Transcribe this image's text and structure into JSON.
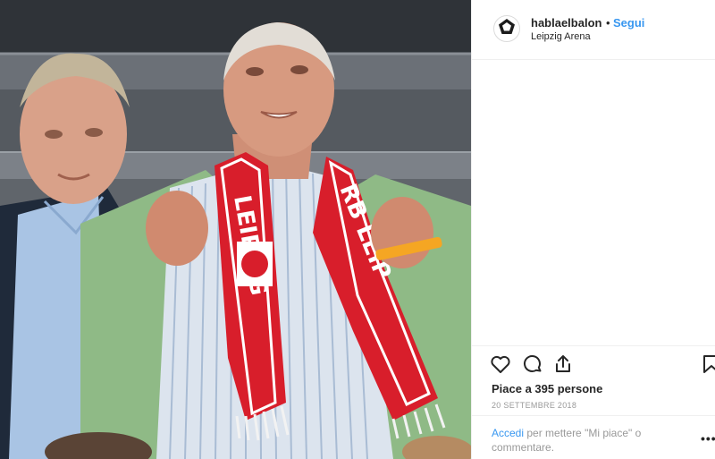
{
  "post": {
    "username": "hablaelbalon",
    "separator": "•",
    "follow_label": "Segui",
    "location": "Leipzig Arena",
    "likes_text": "Piace a 395 persone",
    "date": "20 SETTEMBRE 2018",
    "login_link": "Accedi",
    "login_text": "per mettere \"Mi piace\" o commentare.",
    "more_label": "•••"
  },
  "photo": {
    "scarf_text_left": "LEIPZIG",
    "scarf_text_right": "RB LEIP"
  },
  "icons": {
    "avatar": "pentagon-logo-icon",
    "like": "heart-icon",
    "comment": "comment-icon",
    "share": "share-icon",
    "save": "bookmark-icon"
  },
  "colors": {
    "link": "#3897f0",
    "text": "#262626",
    "muted": "#999999",
    "border": "#efefef",
    "scarf_red": "#d81e2b"
  }
}
